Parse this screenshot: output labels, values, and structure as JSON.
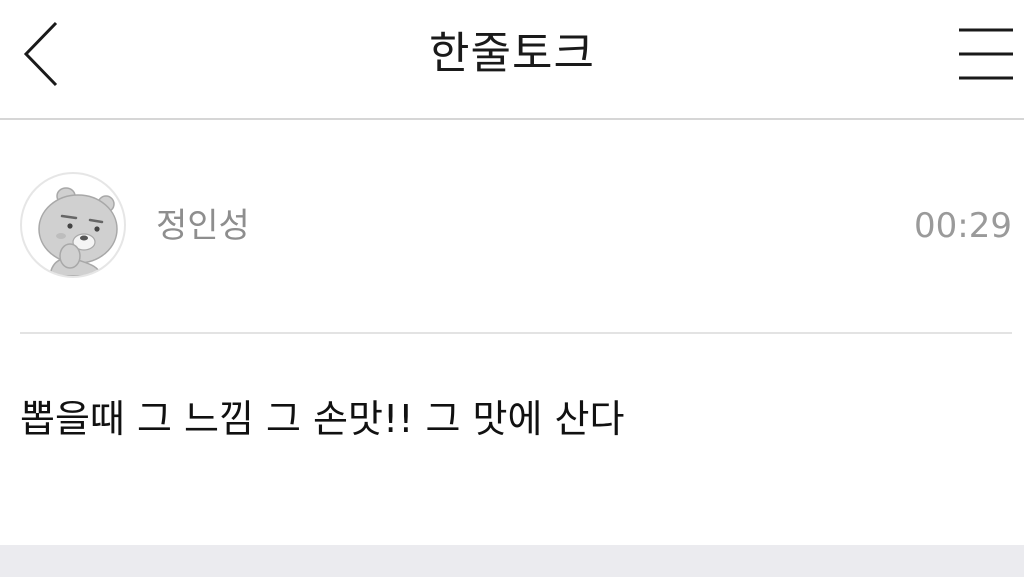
{
  "header": {
    "title": "한줄토크",
    "back_icon": "chevron-left-icon",
    "menu_icon": "hamburger-menu-icon"
  },
  "post": {
    "author": "정인성",
    "time": "00:29",
    "message": "뽑을때 그 느낌 그 손맛!! 그 맛에 산다",
    "avatar_icon": "bear-character-avatar"
  },
  "colors": {
    "header_border": "#d6d6d6",
    "meta_text": "#8e8e8e",
    "footer_band": "#ebebef"
  }
}
